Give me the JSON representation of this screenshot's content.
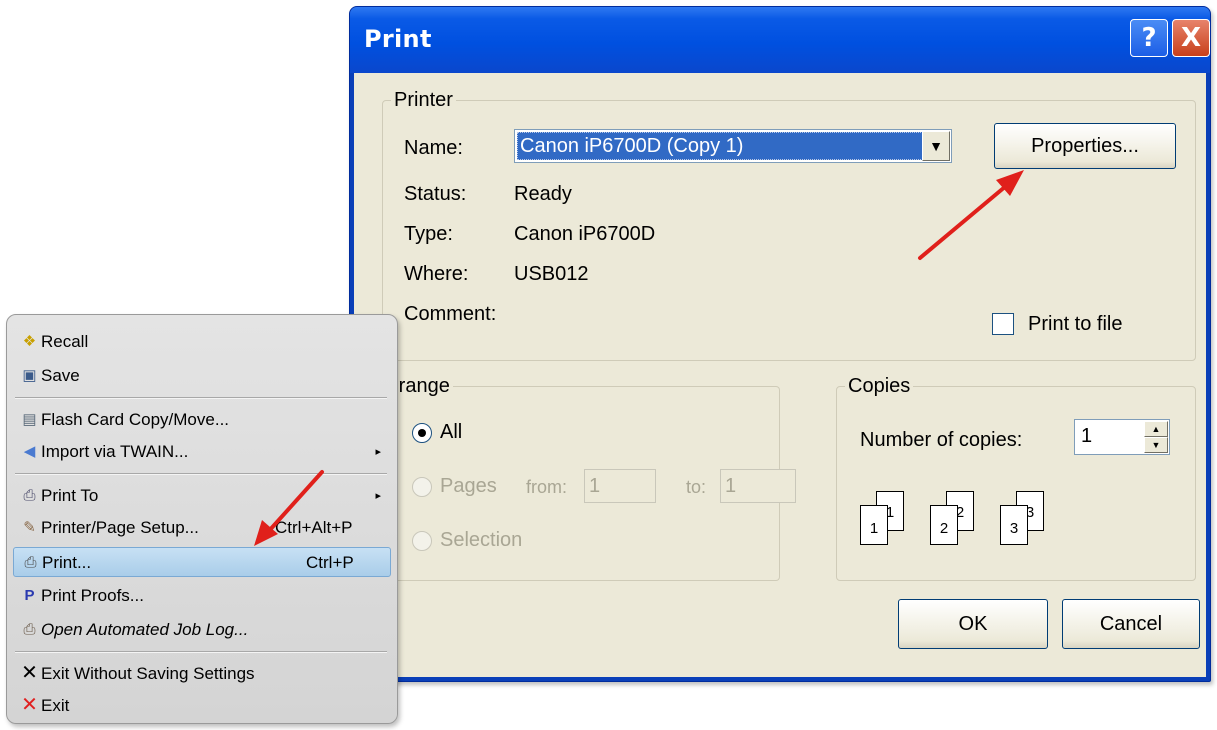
{
  "dialog": {
    "title": "Print",
    "help_glyph": "?",
    "close_glyph": "X",
    "printer_group": {
      "legend": "Printer",
      "name_label": "Name:",
      "name_value": "Canon iP6700D (Copy 1)",
      "status_label": "Status:",
      "status_value": "Ready",
      "type_label": "Type:",
      "type_value": "Canon iP6700D",
      "where_label": "Where:",
      "where_value": "USB012",
      "comment_label": "Comment:",
      "properties_button": "Properties...",
      "print_to_file_label": "Print to file",
      "print_to_file_checked": false
    },
    "range_group": {
      "legend": "Print range",
      "all_label": "All",
      "pages_label": "Pages",
      "from_label": "from:",
      "from_value": "1",
      "to_label": "to:",
      "to_value": "1",
      "selection_label": "Selection",
      "selected": "All"
    },
    "copies_group": {
      "legend": "Copies",
      "number_label": "Number of copies:",
      "number_value": "1",
      "collate_labels": [
        "1",
        "1",
        "2",
        "2",
        "3",
        "3"
      ]
    },
    "ok_button": "OK",
    "cancel_button": "Cancel"
  },
  "menu": {
    "items": [
      {
        "label": "Recall",
        "icon": "recall-icon"
      },
      {
        "label": "Save",
        "icon": "save-icon"
      },
      {
        "label": "Flash Card Copy/Move...",
        "icon": "flash-card-icon"
      },
      {
        "label": "Import via TWAIN...",
        "icon": "twain-icon",
        "submenu": true
      },
      {
        "label": "Print To",
        "icon": "print-to-icon",
        "submenu": true
      },
      {
        "label": "Printer/Page Setup...",
        "icon": "page-setup-icon",
        "shortcut": "Ctrl+Alt+P"
      },
      {
        "label": "Print...",
        "icon": "printer-icon",
        "shortcut": "Ctrl+P",
        "highlighted": true
      },
      {
        "label": "Print Proofs...",
        "icon": "print-proofs-icon"
      },
      {
        "label": "Open Automated Job Log...",
        "icon": "job-log-icon"
      },
      {
        "label": "Exit Without Saving Settings",
        "icon": "exit-black-x-icon"
      },
      {
        "label": "Exit",
        "icon": "exit-red-x-icon"
      }
    ],
    "submenu_glyph": "▸"
  },
  "colors": {
    "titlebar": "#0050e0",
    "dialog_face": "#ece9d8",
    "selection": "#316ac5",
    "annotation_arrow": "#e0201b",
    "menu_highlight": "#b8d6ee"
  }
}
